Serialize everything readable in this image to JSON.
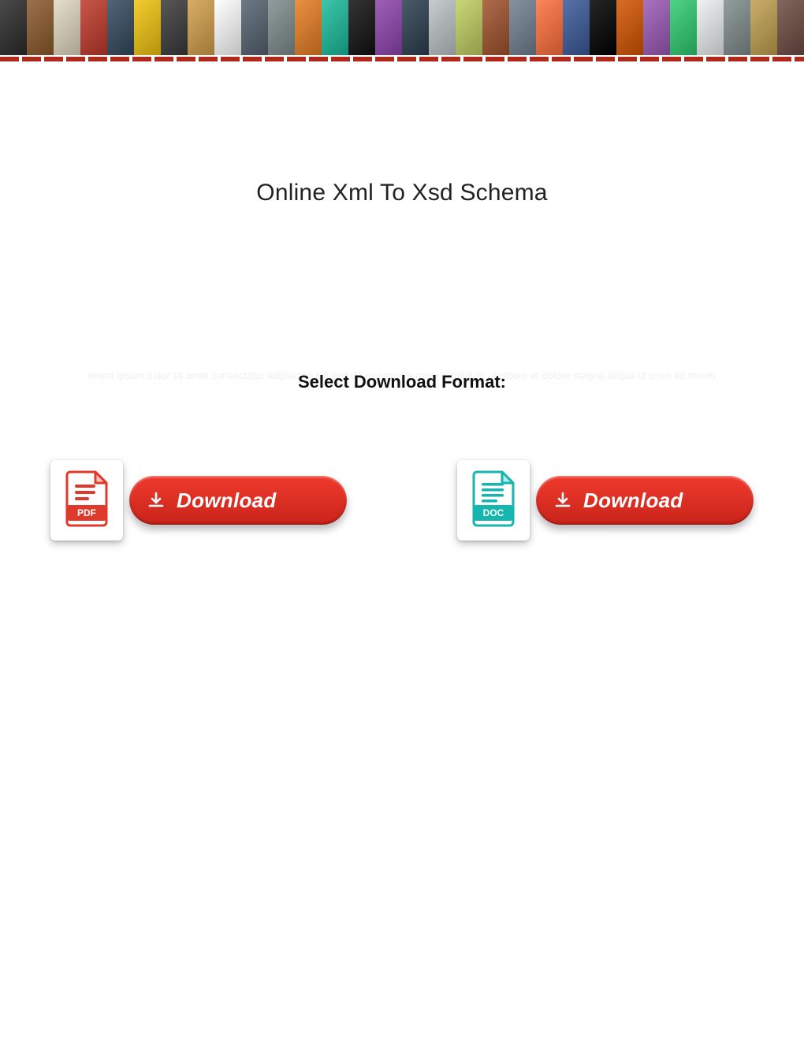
{
  "header": {
    "title": "Online Xml To Xsd Schema"
  },
  "subtitle": {
    "label": "Select Download Format:",
    "faint_text": "lorem ipsum dolor sit amet consectetur adipiscing elit sed do eiusmod tempor incididunt ut labore et dolore magna aliqua ut enim ad minim"
  },
  "downloads": {
    "pdf": {
      "label": "Download",
      "icon_name": "pdf-file-icon",
      "badge": "PDF"
    },
    "doc": {
      "label": "Download",
      "icon_name": "doc-file-icon",
      "badge": "DOC"
    }
  },
  "banner_colors": [
    "#2b2b2b",
    "#8a5a2b",
    "#e0d8c0",
    "#c0392b",
    "#34495e",
    "#f1c40f",
    "#3a3a3a",
    "#d2a04a",
    "#ffffff",
    "#556270",
    "#7e8c8d",
    "#e67e22",
    "#1abc9c",
    "#111111",
    "#8e44ad",
    "#2c3e50",
    "#bdc3c7",
    "#c0d060",
    "#a0522d",
    "#708090",
    "#ff6f3c",
    "#3b5998",
    "#000000",
    "#d35400",
    "#9b59b6",
    "#2ecc71",
    "#ecf0f1",
    "#7f8c8d",
    "#c0a050",
    "#6d4c41"
  ]
}
